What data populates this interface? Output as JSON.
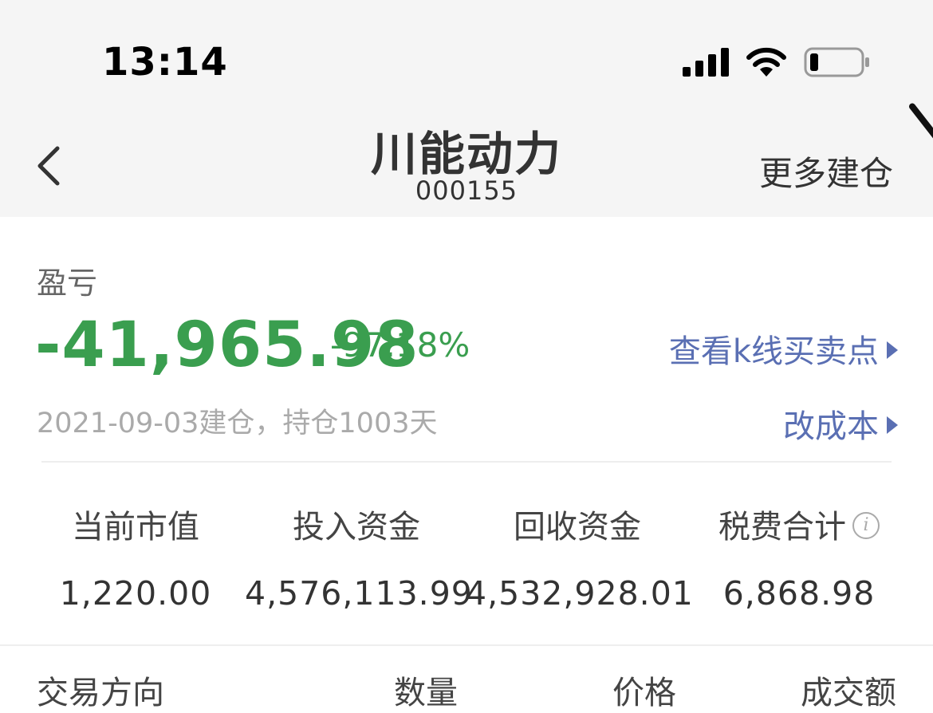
{
  "status_bar": {
    "time": "13:14"
  },
  "header": {
    "title": "川能动力",
    "code": "000155",
    "more_label": "更多建仓"
  },
  "pnl": {
    "label": "盈亏",
    "value": "-41,965.98",
    "percent": "-97.18%",
    "kline_link": "查看k线买卖点",
    "build_info": "2021-09-03建仓，持仓1003天",
    "cost_link": "改成本",
    "loss_color": "#3a9e4f",
    "link_color": "#5a6fb3"
  },
  "stats": [
    {
      "label": "当前市值",
      "value": "1,220.00"
    },
    {
      "label": "投入资金",
      "value": "4,576,113.99"
    },
    {
      "label": "回收资金",
      "value": "4,532,928.01"
    },
    {
      "label": "税费合计",
      "value": "6,868.98"
    }
  ],
  "table_headers": {
    "direction": "交易方向",
    "quantity": "数量",
    "price": "价格",
    "amount": "成交额"
  },
  "icons": {
    "back": "chevron-left-icon",
    "info": "info-icon",
    "signal": "signal-icon",
    "wifi": "wifi-icon",
    "battery": "battery-icon"
  }
}
